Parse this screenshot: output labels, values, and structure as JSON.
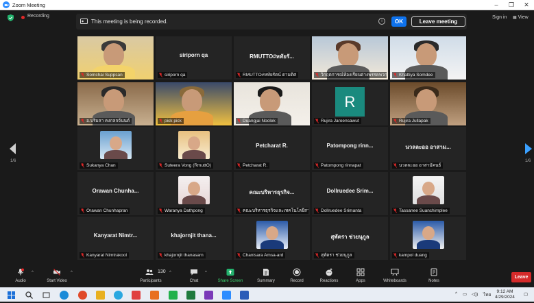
{
  "window": {
    "title": "Zoom Meeting"
  },
  "top": {
    "recording_label": "Recording",
    "banner_text": "This meeting is being recorded.",
    "ok_label": "OK",
    "leave_meeting_label": "Leave meeting",
    "sign_in_label": "Sign in",
    "view_label": "View"
  },
  "pager": {
    "left": "1/6",
    "right": "1/6"
  },
  "participants": [
    {
      "name": "Somchai Suppsan",
      "big": "",
      "kind": "video",
      "active": true
    },
    {
      "name": "siriporn qa",
      "big": "siriporn qa",
      "kind": "name"
    },
    {
      "name": "RMUTTO#หทัยรัตน์ ตามดิศ",
      "big": "RMUTTO#หทัยรั...",
      "kind": "name"
    },
    {
      "name": "วิกฤตการณ์ห้องเรียนต่างพรรคพวกออนไลน์",
      "big": "",
      "kind": "video"
    },
    {
      "name": "Khattiya Somdee",
      "big": "",
      "kind": "video"
    },
    {
      "name": "อ.ปริมลา คงกลจจันนด์",
      "big": "",
      "kind": "video"
    },
    {
      "name": "pick pick",
      "big": "",
      "kind": "video"
    },
    {
      "name": "Duangjai Noolek",
      "big": "",
      "kind": "video"
    },
    {
      "name": "Rujira Jaroensawut",
      "big": "",
      "kind": "initial",
      "initial": "R"
    },
    {
      "name": "Rujira Jullapak",
      "big": "",
      "kind": "video"
    },
    {
      "name": "Sukanya Chan",
      "big": "",
      "kind": "avatar"
    },
    {
      "name": "Suteera Vong (RmuttO)",
      "big": "",
      "kind": "avatar"
    },
    {
      "name": "Petcharat R.",
      "big": "Petcharat R.",
      "kind": "name"
    },
    {
      "name": "Patompong rinnapat",
      "big": "Patompong rinn...",
      "kind": "name"
    },
    {
      "name": "นวลละออ อาสามัคนธ์",
      "big": "นวลละออ อาสาม...",
      "kind": "name"
    },
    {
      "name": "Orawan Chunhapran",
      "big": "Orawan Chunha...",
      "kind": "name"
    },
    {
      "name": "Waranya Dathpong",
      "big": "",
      "kind": "avatar"
    },
    {
      "name": "คณะบริหารธุรกิจและเทคโนโลยีสารสนเทศ",
      "big": "คณะบริหารธุรกิจ...",
      "kind": "name"
    },
    {
      "name": "Dollruedee Srimanta",
      "big": "Dollruedee Srim...",
      "kind": "name"
    },
    {
      "name": "Tassanee Suanchimplee",
      "big": "",
      "kind": "avatar"
    },
    {
      "name": "Kanyarat Nimtrakool",
      "big": "Kanyarat Nimtr...",
      "kind": "name"
    },
    {
      "name": "khajornjit thanasarn",
      "big": "khajornjit thana...",
      "kind": "name"
    },
    {
      "name": "Chanisara Amsa-ard",
      "big": "",
      "kind": "avatar"
    },
    {
      "name": "สุพัตรา ช่วยนุกูล",
      "big": "สุพัตรา ช่วยนุกูล",
      "kind": "name"
    },
    {
      "name": "kampol duang",
      "big": "",
      "kind": "avatar"
    }
  ],
  "toolbar": {
    "audio": "Audio",
    "start_video": "Start Video",
    "participants": "Participants",
    "participants_count": "130",
    "chat": "Chat",
    "share_screen": "Share Screen",
    "summary": "Summary",
    "record": "Record",
    "reactions": "Reactions",
    "apps": "Apps",
    "whiteboards": "Whiteboards",
    "notes": "Notes",
    "leave": "Leave"
  },
  "taskbar": {
    "time": "9:12 AM",
    "date": "4/29/2024",
    "lang": "ไทย",
    "apps": [
      "windows-icon",
      "search-icon",
      "task-view-icon",
      "edge-icon",
      "chrome-icon",
      "explorer-icon",
      "chrome-icon",
      "vivaldi-icon",
      "powerpoint-icon",
      "line-icon",
      "excel-icon",
      "onenote-icon",
      "zoom-icon",
      "word-icon"
    ]
  },
  "colors": {
    "accent_blue": "#0e72ed",
    "share_green": "#3bd16f",
    "recording_red": "#e02828",
    "leave_red": "#d42a2a",
    "active_speaker": "#e7e34a"
  }
}
